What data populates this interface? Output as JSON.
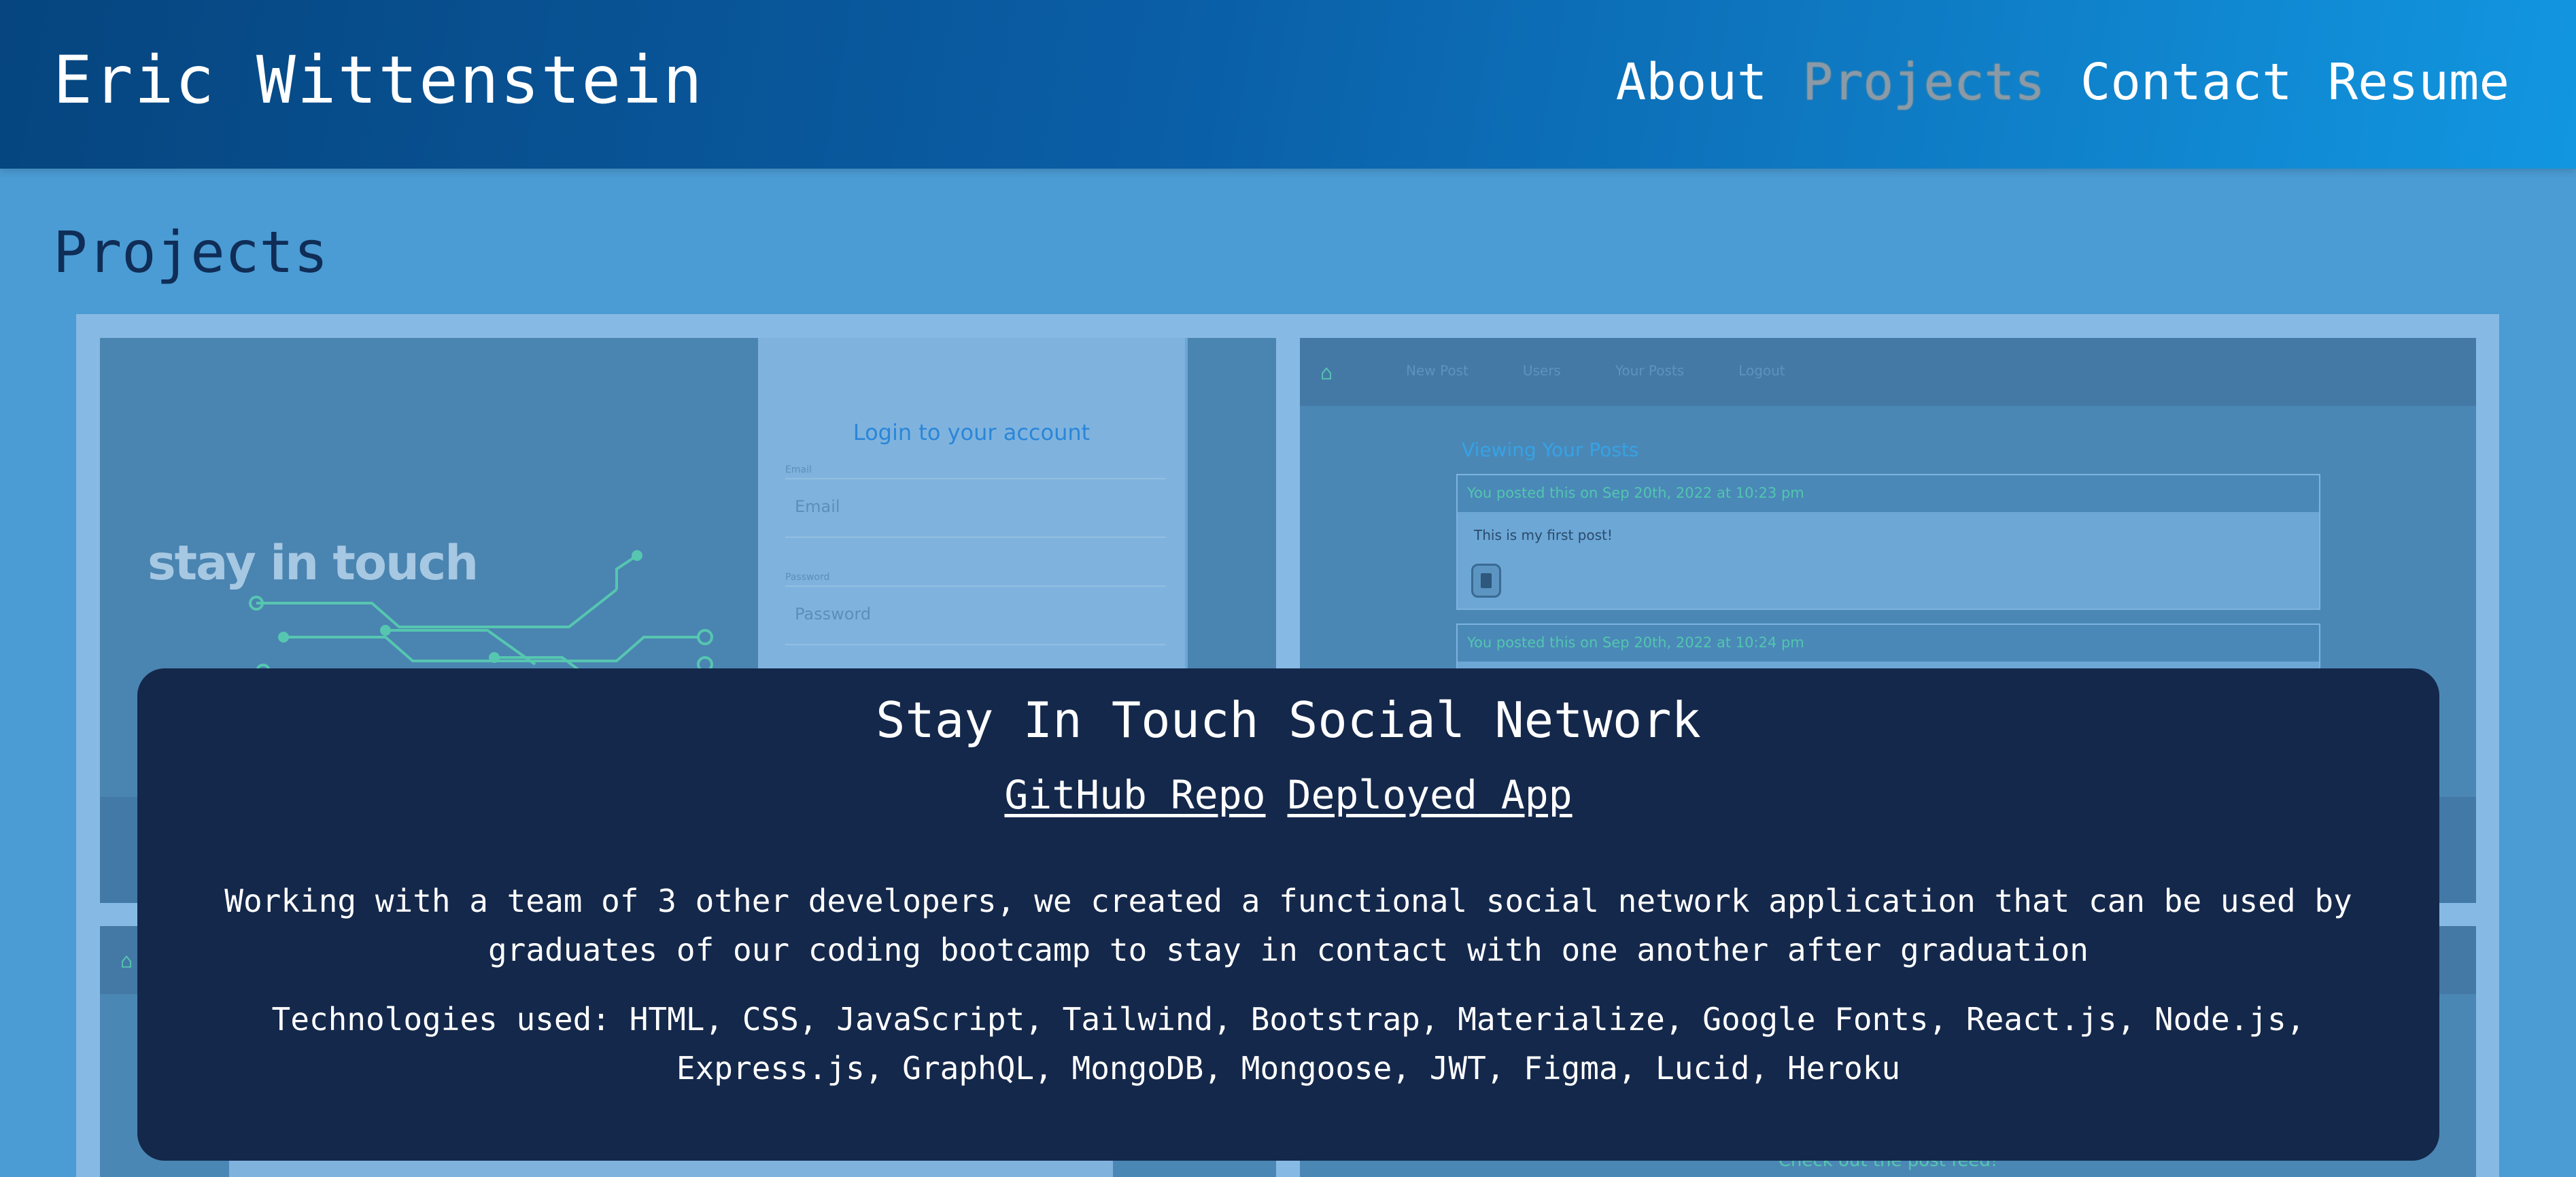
{
  "header": {
    "site_title": "Eric Wittenstein",
    "nav": {
      "about": "About",
      "projects": "Projects",
      "contact": "Contact",
      "resume": "Resume"
    }
  },
  "main": {
    "heading": "Projects"
  },
  "cards": {
    "login_preview": {
      "logo_text": "stay in touch",
      "form_title": "Login to your account",
      "email_label": "Email",
      "email_placeholder": "Email",
      "password_label": "Password",
      "password_placeholder": "Password"
    },
    "posts_preview": {
      "nav_links": [
        "New Post",
        "Users",
        "Your Posts",
        "Logout"
      ],
      "section_title": "Viewing Your Posts",
      "post1_meta": "You posted this on Sep 20th, 2022 at 10:23 pm",
      "post1_body": "This is my first post!",
      "post2_meta": "You posted this on Sep 20th, 2022 at 10:24 pm"
    },
    "feed_preview": {
      "cta": "Check out the post feed!"
    }
  },
  "overlay": {
    "title": "Stay In Touch Social Network",
    "github_link": "GitHub Repo",
    "deployed_link": "Deployed App",
    "description": "Working with a team of 3 other developers, we created a functional social network application that can be used by graduates of our coding bootcamp to stay in contact with one another after graduation",
    "technologies": "Technologies used: HTML, CSS, JavaScript, Tailwind, Bootstrap, Materialize, Google Fonts, React.js, Node.js, Express.js, GraphQL, MongoDB, Mongoose, JWT, Figma, Lucid, Heroku"
  },
  "colors": {
    "header_start": "#06457f",
    "header_end": "#1296e0",
    "page_background": "#4b9bd4",
    "overlay_background": "#14284b",
    "accent_green": "#56c6b0"
  },
  "icons": [
    "home-icon",
    "trash-icon",
    "circuit-lines-icon"
  ]
}
